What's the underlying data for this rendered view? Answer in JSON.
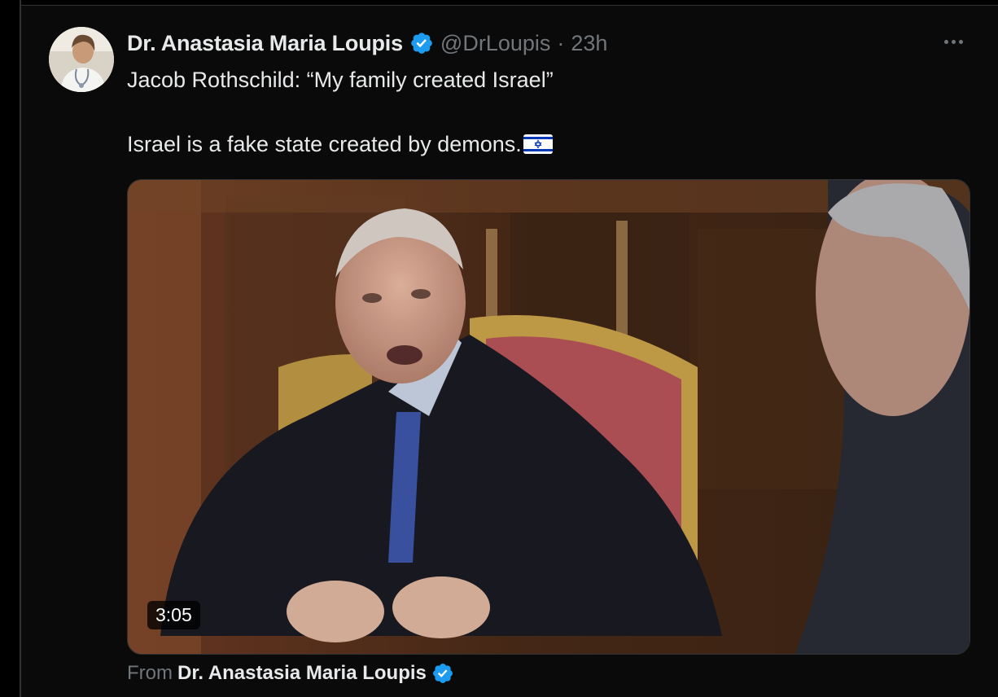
{
  "tweet": {
    "author": {
      "display_name": "Dr. Anastasia Maria Loupis",
      "handle": "@DrLoupis",
      "verified": true,
      "avatar_icon": "avatar-photo"
    },
    "separator": "·",
    "timestamp": "23h",
    "more_icon": "more-options-icon",
    "text_line_1": "Jacob Rothschild: “My family created Israel”",
    "text_line_2": "Israel is a fake state created by demons.",
    "emoji": "israel-flag-emoji",
    "media": {
      "type": "video",
      "duration": "3:05"
    },
    "attribution": {
      "prefix": "From",
      "name": "Dr. Anastasia Maria Loupis",
      "verified": true
    }
  },
  "colors": {
    "background": "#000000",
    "text_primary": "#e7e9ea",
    "text_secondary": "#71767b",
    "verified_blue": "#1d9bf0",
    "border": "#2f3336"
  }
}
